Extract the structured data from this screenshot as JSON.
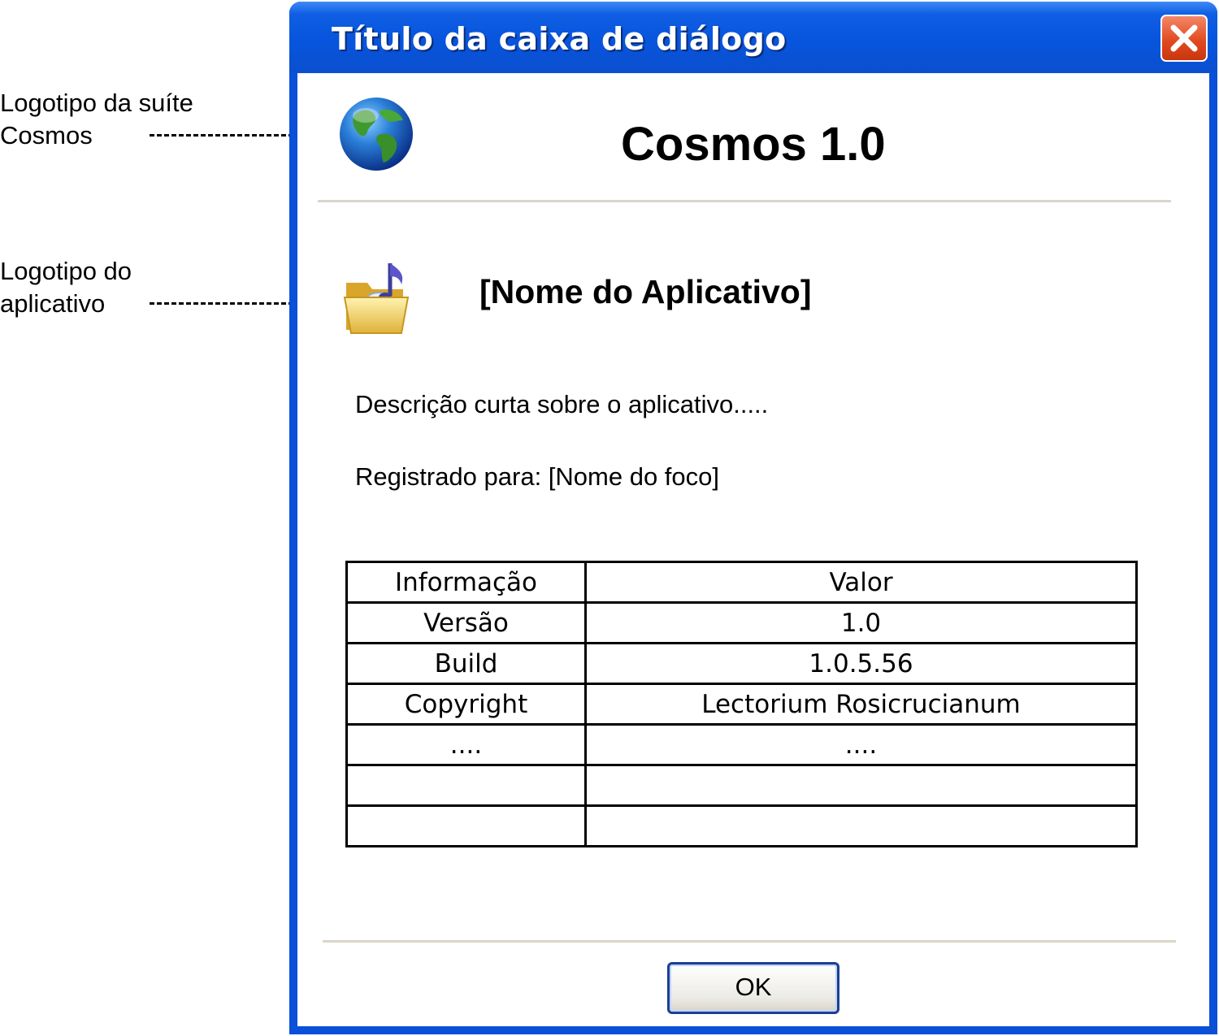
{
  "annotations": {
    "suite_logo": [
      "Logotipo da suíte",
      "Cosmos"
    ],
    "app_logo": [
      "Logotipo do",
      "aplicativo"
    ]
  },
  "dialog": {
    "title": "Título da caixa de diálogo",
    "suite_name": "Cosmos 1.0",
    "app_name": "[Nome do Aplicativo]",
    "description": "Descrição curta sobre o aplicativo.....",
    "registered": "Registrado para: [Nome do foco]",
    "ok_label": "OK"
  },
  "table": {
    "headers": [
      "Informação",
      "Valor"
    ],
    "rows": [
      [
        "Versão",
        "1.0"
      ],
      [
        "Build",
        "1.0.5.56"
      ],
      [
        "Copyright",
        "Lectorium Rosicrucianum"
      ],
      [
        "....",
        "...."
      ],
      [
        "",
        ""
      ],
      [
        "",
        ""
      ]
    ]
  },
  "icons": {
    "suite_logo": "globe-icon",
    "app_logo": "folder-music-icon",
    "close": "close-icon"
  },
  "colors": {
    "titlebar": "#0a50d8",
    "close_button": "#e24b21",
    "separator": "#d9d6c8"
  }
}
